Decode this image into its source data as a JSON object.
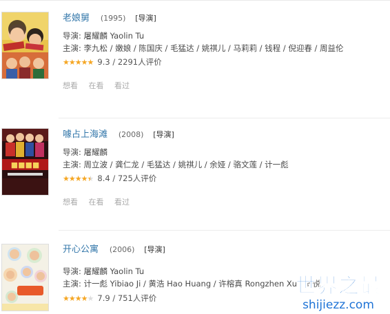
{
  "entries": [
    {
      "title": "老娘舅",
      "year": "(1995)",
      "role": "[导演]",
      "director_line": "导演: 屠耀麟 Yaolin Tu",
      "cast_line": "主演: 李九松 / 嫩娘 / 陈国庆 / 毛猛达 / 姚祺儿 / 马莉莉 / 钱程 / 倪迎春 / 周益伦",
      "rating_stars": 5,
      "rating_text": "9.3 / 2291人评价",
      "actions": [
        "想看",
        "在看",
        "看过"
      ]
    },
    {
      "title": "噱占上海滩",
      "year": "(2008)",
      "role": "[导演]",
      "director_line": "导演: 屠耀麟",
      "cast_line": "主演: 周立波 / 龚仁龙 / 毛猛达 / 姚祺儿 / 余娅 / 骆文莲 / 计一彪",
      "rating_stars": 4.5,
      "rating_text": "8.4 / 725人评价",
      "actions": [
        "想看",
        "在看",
        "看过"
      ]
    },
    {
      "title": "开心公寓",
      "year": "(2006)",
      "role": "[导演]",
      "director_line": "导演: 屠耀麟 Yaolin Tu",
      "cast_line": "主演: 计一彪 Yibiao Ji / 黄浩 Hao Huang / 许榕真 Rongzhen Xu / 舒悦",
      "rating_stars": 4,
      "rating_text": "7.9 / 751人评价",
      "actions": []
    }
  ],
  "watermark": {
    "title": "世界之最",
    "url": "shijiezz.com"
  },
  "colors": {
    "link": "#3377aa",
    "star": "#f5a623",
    "watermark": "#1e73d6"
  }
}
